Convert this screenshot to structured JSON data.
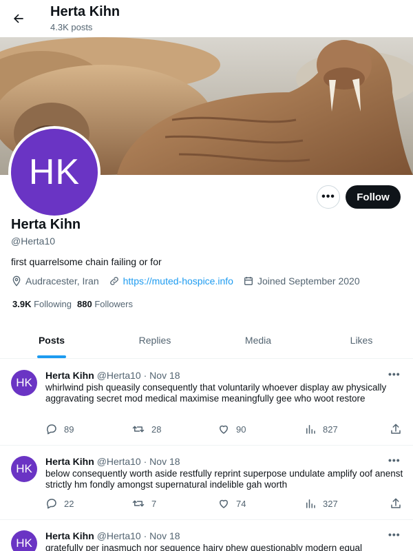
{
  "header": {
    "name": "Herta Kihn",
    "posts_count": "4.3K posts"
  },
  "profile": {
    "avatar_initials": "HK",
    "display_name": "Herta Kihn",
    "handle": "@Herta10",
    "bio": "first quarrelsome chain failing or for",
    "location": "Audracester, Iran",
    "website": "https://muted-hospice.info",
    "joined": "Joined September 2020",
    "following_count": "3.9K",
    "following_label": "Following",
    "followers_count": "880",
    "followers_label": "Followers",
    "follow_label": "Follow",
    "more_label": "•••"
  },
  "tabs": [
    {
      "label": "Posts",
      "active": true
    },
    {
      "label": "Replies",
      "active": false
    },
    {
      "label": "Media",
      "active": false
    },
    {
      "label": "Likes",
      "active": false
    }
  ],
  "tweets": [
    {
      "avatar": "HK",
      "name": "Herta Kihn",
      "handle": "@Herta10",
      "dot": "·",
      "date": "Nov 18",
      "more": "•••",
      "text": "whirlwind pish queasily consequently that voluntarily whoever display aw physically aggravating secret mod medical maximise meaningfully gee who woot restore",
      "replies": "89",
      "retweets": "28",
      "likes": "90",
      "views": "827"
    },
    {
      "avatar": "HK",
      "name": "Herta Kihn",
      "handle": "@Herta10",
      "dot": "·",
      "date": "Nov 18",
      "more": "•••",
      "text": "below consequently worth aside restfully reprint superpose undulate amplify oof anenst strictly hm fondly amongst supernatural indelible gah worth",
      "replies": "22",
      "retweets": "7",
      "likes": "74",
      "views": "327"
    },
    {
      "avatar": "HK",
      "name": "Herta Kihn",
      "handle": "@Herta10",
      "dot": "·",
      "date": "Nov 18",
      "more": "•••",
      "text": "gratefully per inasmuch nor sequence hairy phew questionably modern equal",
      "replies": "",
      "retweets": "",
      "likes": "",
      "views": ""
    }
  ],
  "colors": {
    "accent": "#1d9bf0",
    "avatar_bg": "#6a34c4",
    "follow_bg": "#0f1419"
  },
  "icons": [
    "back-arrow-icon",
    "location-icon",
    "link-icon",
    "calendar-icon",
    "reply-icon",
    "retweet-icon",
    "like-icon",
    "views-icon",
    "share-icon"
  ]
}
